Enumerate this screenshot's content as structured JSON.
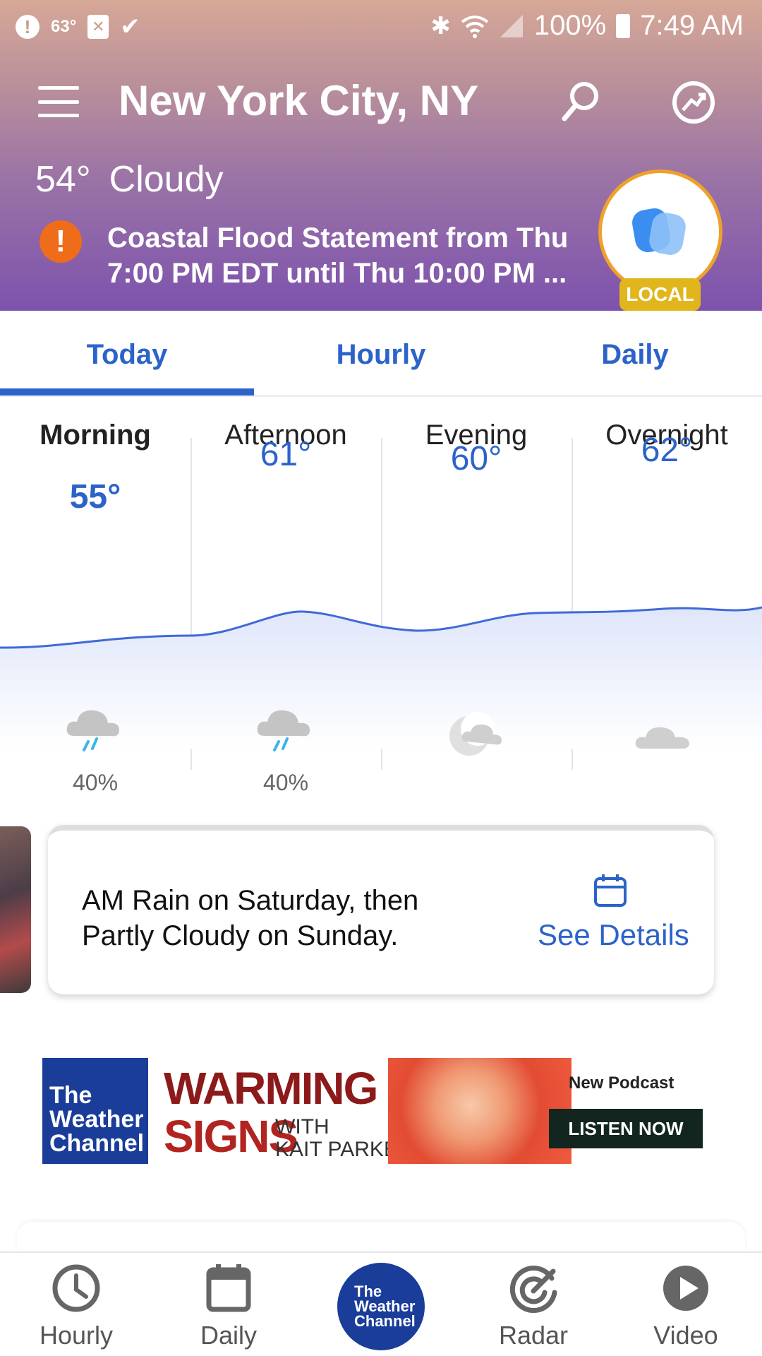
{
  "status_bar": {
    "temp": "63°",
    "battery": "100%",
    "time": "7:49 AM"
  },
  "header": {
    "city": "New York City, NY",
    "temperature": "54°",
    "condition": "Cloudy",
    "alert": "Coastal Flood Statement from Thu 7:00 PM EDT until Thu 10:00 PM ...",
    "local_badge": "LOCAL"
  },
  "tabs": [
    {
      "label": "Today",
      "active": true
    },
    {
      "label": "Hourly",
      "active": false
    },
    {
      "label": "Daily",
      "active": false
    }
  ],
  "today": {
    "periods": [
      {
        "label": "Morning",
        "temp": "55°",
        "icon": "rain-cloud-icon",
        "precip": "40%"
      },
      {
        "label": "Afternoon",
        "temp": "61°",
        "icon": "rain-cloud-icon",
        "precip": "40%"
      },
      {
        "label": "Evening",
        "temp": "60°",
        "icon": "moon-cloud-icon",
        "precip": ""
      },
      {
        "label": "Overnight",
        "temp": "62°",
        "icon": "cloud-icon",
        "precip": ""
      }
    ],
    "accent_color": "#2c63c9"
  },
  "details_card": {
    "text": "AM Rain on Saturday, then Partly Cloudy on Sunday.",
    "link": "See Details"
  },
  "ad": {
    "logo": "The Weather Channel",
    "title_line1": "WARMING",
    "title_line2": "SIGNS",
    "with_line1": "WITH",
    "with_line2": "KAIT PARKER",
    "podcast": "New Podcast",
    "cta": "LISTEN NOW"
  },
  "bottom_nav": {
    "hourly": "Hourly",
    "daily": "Daily",
    "center_logo": "The Weather Channel",
    "radar": "Radar",
    "video": "Video"
  }
}
